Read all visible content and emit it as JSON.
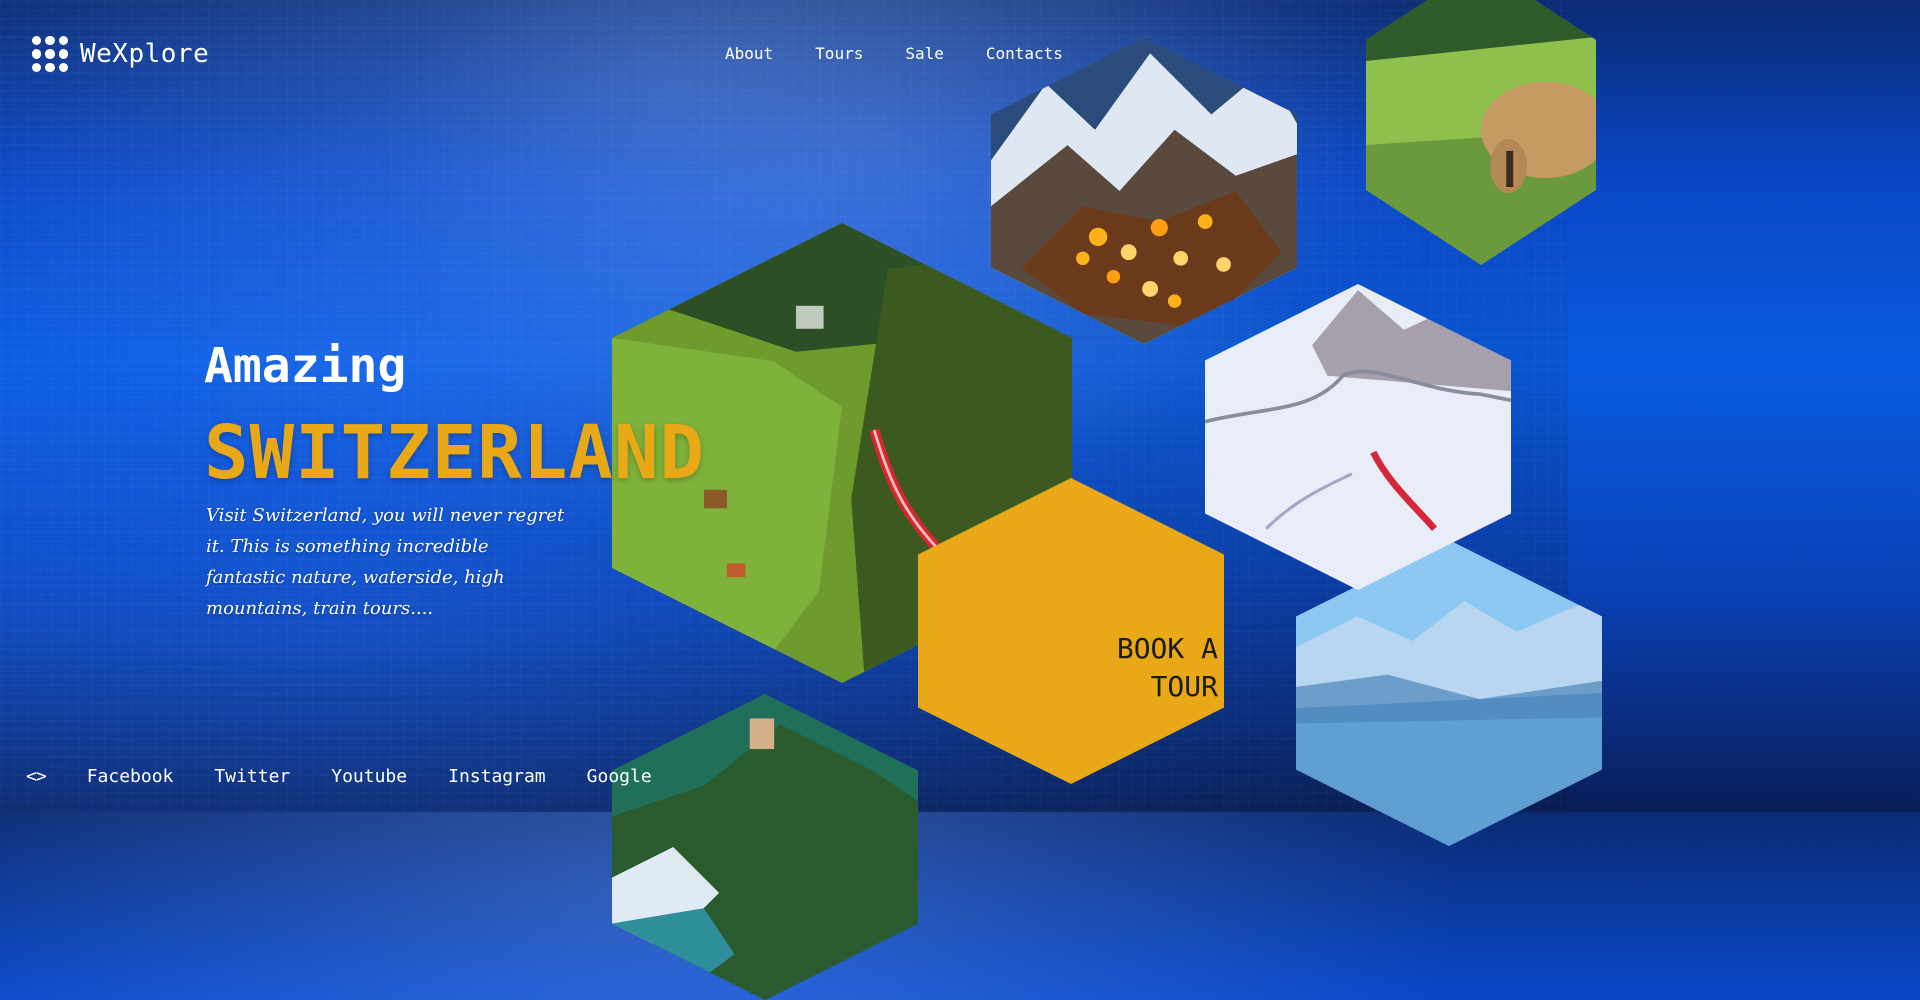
{
  "brand": {
    "name": "WeXplore",
    "logo_icon": "grid-dots-icon"
  },
  "nav": {
    "items": [
      "About",
      "Tours",
      "Sale",
      "Contacts"
    ]
  },
  "hero": {
    "kicker": "Amazing",
    "title": "SWITZERLAND",
    "text": "Visit Switzerland, you will never regret it. This is something incredible fantastic nature, waterside, high mountains, train tours...."
  },
  "cta": {
    "label_line_1": "BOOK A",
    "label_line_2": "TOUR"
  },
  "footer": {
    "code_icon": "<>",
    "links": [
      "Facebook",
      "Twitter",
      "Youtube",
      "Instagram",
      "Google"
    ]
  },
  "colors": {
    "accent": "#e8a817",
    "text": "#ffffff",
    "background": "#0a5be0"
  }
}
